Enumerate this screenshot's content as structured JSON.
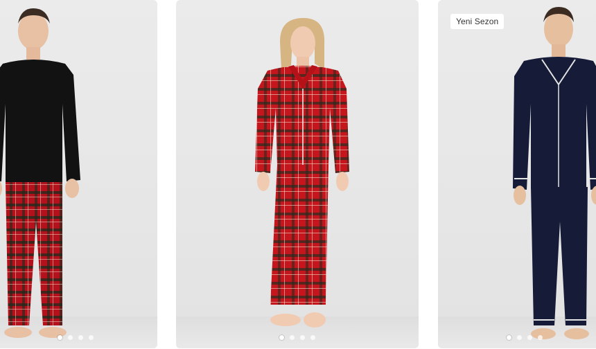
{
  "products": [
    {
      "name": "man-black-top-red-plaid-pajama",
      "badge": "",
      "slides": 4,
      "active_slide": 0,
      "colors": {
        "top": "#121212",
        "bottom": "#b3121c",
        "plaid": "#1c2a1c",
        "skin": "#e8c0a3"
      }
    },
    {
      "name": "woman-red-plaid-pajama-set",
      "badge": "",
      "slides": 4,
      "active_slide": 0,
      "colors": {
        "top": "#c4161c",
        "bottom": "#c4161c",
        "plaid": "#1f2d20",
        "skin": "#f1cbb1"
      }
    },
    {
      "name": "man-navy-pajama-set",
      "badge": "Yeni Sezon",
      "slides": 4,
      "active_slide": 0,
      "colors": {
        "top": "#161b38",
        "bottom": "#161b38",
        "piping": "#e4e4e4",
        "skin": "#e6bf9f"
      }
    }
  ]
}
